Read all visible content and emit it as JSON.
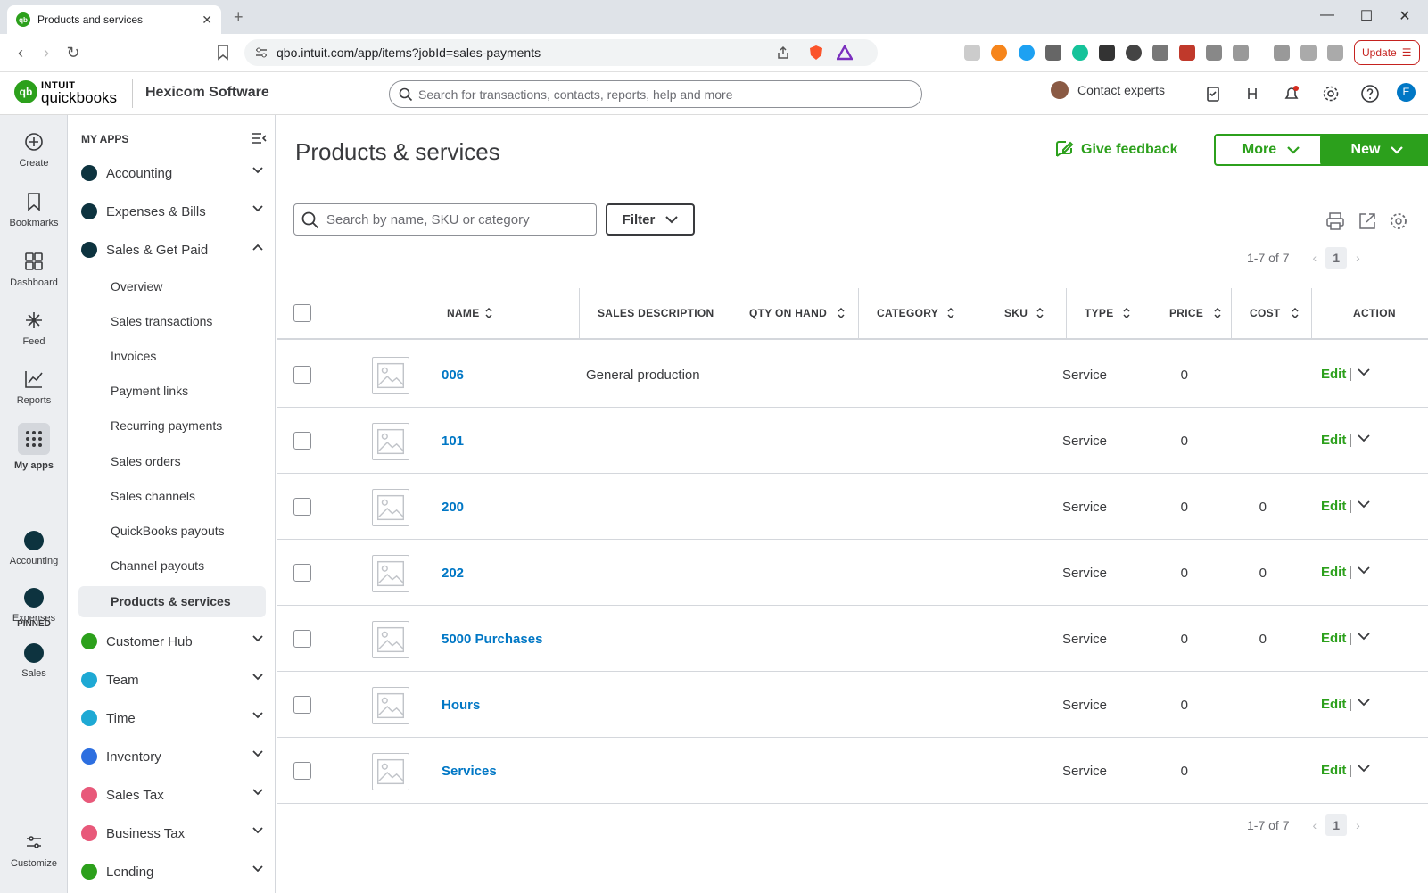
{
  "browser": {
    "tab_title": "Products and services",
    "url": "qbo.intuit.com/app/items?jobId=sales-payments",
    "update_label": "Update"
  },
  "header": {
    "brand_intuit": "INTUIT",
    "brand_qb": "quickbooks",
    "company": "Hexicom Software",
    "search_placeholder": "Search for transactions, contacts, reports, help and more",
    "contact_experts": "Contact experts",
    "user_initial": "E"
  },
  "rail": {
    "create": "Create",
    "bookmarks": "Bookmarks",
    "dashboard": "Dashboard",
    "feed": "Feed",
    "reports": "Reports",
    "my_apps": "My apps",
    "pinned": "PINNED",
    "pin_accounting": "Accounting",
    "pin_expenses": "Expenses",
    "pin_sales": "Sales",
    "customize": "Customize"
  },
  "apps": {
    "header": "MY APPS",
    "groups": [
      {
        "label": "Accounting"
      },
      {
        "label": "Expenses & Bills"
      },
      {
        "label": "Sales & Get Paid"
      },
      {
        "label": "Customer Hub"
      },
      {
        "label": "Team"
      },
      {
        "label": "Time"
      },
      {
        "label": "Inventory"
      },
      {
        "label": "Sales Tax"
      },
      {
        "label": "Business Tax"
      },
      {
        "label": "Lending"
      }
    ],
    "sales_items": [
      "Overview",
      "Sales transactions",
      "Invoices",
      "Payment links",
      "Recurring payments",
      "Sales orders",
      "Sales channels",
      "QuickBooks payouts",
      "Channel payouts",
      "Products & services"
    ]
  },
  "page": {
    "title": "Products & services",
    "give_feedback": "Give feedback",
    "more": "More",
    "new": "New",
    "search_placeholder": "Search by name, SKU or category",
    "filter": "Filter",
    "pagination_text": "1-7 of 7",
    "current_page": "1"
  },
  "table": {
    "columns": {
      "name": "NAME",
      "sales_description": "SALES DESCRIPTION",
      "qty_on_hand": "QTY ON HAND",
      "category": "CATEGORY",
      "sku": "SKU",
      "type": "TYPE",
      "price": "PRICE",
      "cost": "COST",
      "action": "ACTION"
    },
    "edit_label": "Edit",
    "rows": [
      {
        "name": "006",
        "description": "General production",
        "type": "Service",
        "price": "0",
        "cost": ""
      },
      {
        "name": "101",
        "description": "",
        "type": "Service",
        "price": "0",
        "cost": ""
      },
      {
        "name": "200",
        "description": "",
        "type": "Service",
        "price": "0",
        "cost": "0"
      },
      {
        "name": "202",
        "description": "",
        "type": "Service",
        "price": "0",
        "cost": "0"
      },
      {
        "name": "5000 Purchases",
        "description": "",
        "type": "Service",
        "price": "0",
        "cost": "0"
      },
      {
        "name": "Hours",
        "description": "",
        "type": "Service",
        "price": "0",
        "cost": ""
      },
      {
        "name": "Services",
        "description": "",
        "type": "Service",
        "price": "0",
        "cost": ""
      }
    ]
  },
  "colors": {
    "brand_green": "#2ca01c",
    "link_blue": "#0077c5",
    "text": "#393a3d"
  }
}
